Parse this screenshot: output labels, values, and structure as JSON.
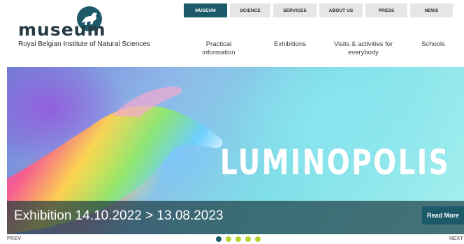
{
  "logo": {
    "text": "museum",
    "icon": "dinosaur-icon",
    "brand_color": "#1c5a69"
  },
  "tagline": "Royal Belgian Institute of Natural Sciences",
  "topnav": {
    "tabs": [
      {
        "label": "MUSEUM",
        "active": true
      },
      {
        "label": "SCIENCE",
        "active": false
      },
      {
        "label": "SERVICES",
        "active": false
      },
      {
        "label": "ABOUT US",
        "active": false
      },
      {
        "label": "PRESS",
        "active": false
      },
      {
        "label": "NEWS",
        "active": false
      }
    ]
  },
  "subnav": {
    "items": [
      {
        "label": "Practical information"
      },
      {
        "label": "Exhibitions"
      },
      {
        "label": "Visits & activities for everybody"
      },
      {
        "label": "Schools"
      }
    ]
  },
  "hero": {
    "title": "LUMINOPOLIS",
    "caption": "Exhibition 14.10.2022 > 13.08.2023",
    "read_more": "Read More"
  },
  "pager": {
    "prev": "PREV",
    "next": "NEXT",
    "active_dot": 1,
    "dot_count": 5
  },
  "colors": {
    "accent": "#1c5a69",
    "dot": "#b7d433"
  }
}
